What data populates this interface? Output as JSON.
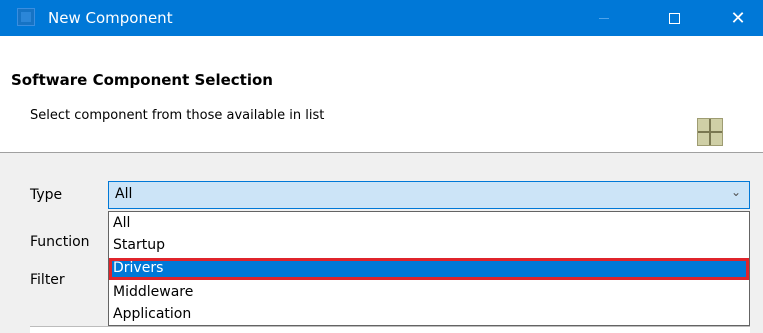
{
  "window": {
    "title": "New Component"
  },
  "header": {
    "title": "Software Component Selection",
    "description": "Select component from those available in list"
  },
  "form": {
    "type_label": "Type",
    "function_label": "Function",
    "filter_label": "Filter",
    "type_value": "All"
  },
  "dropdown": {
    "items": [
      {
        "label": "All"
      },
      {
        "label": "Startup"
      },
      {
        "label": "Drivers"
      },
      {
        "label": "Middleware"
      },
      {
        "label": "Application"
      }
    ],
    "selected": "Drivers",
    "highlight_color": "#e0242b"
  },
  "colors": {
    "titlebar": "#0078d7",
    "selection": "#0078d7",
    "combo_background": "#cce4f7"
  },
  "icons": {
    "app": "app-icon",
    "minimize": "minimize-icon",
    "maximize": "maximize-icon",
    "close": "close-icon",
    "component": "component-grid-icon",
    "combo_arrow": "chevron-down-icon"
  }
}
